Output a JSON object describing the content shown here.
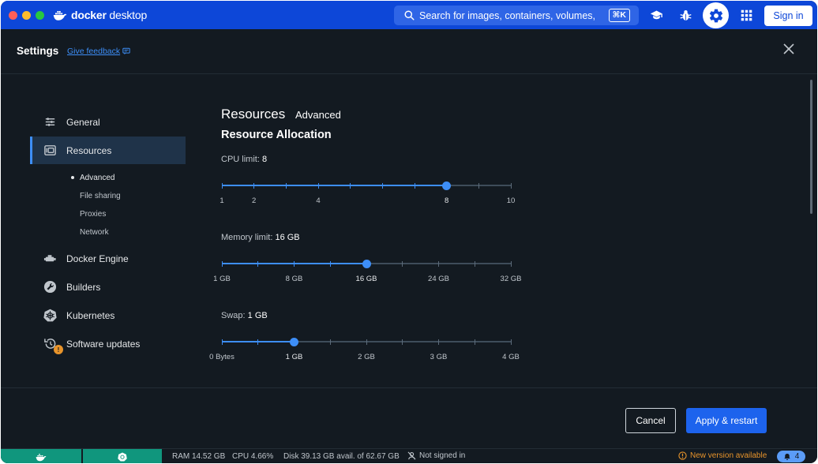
{
  "titlebar": {
    "brand": "docker desktop",
    "brand_bold": "docker",
    "brand_light": " desktop",
    "search_placeholder": "Search for images, containers, volumes, e...",
    "search_shortcut": "⌘K",
    "sign_in": "Sign in",
    "accent": "#0d47d8"
  },
  "header": {
    "title": "Settings",
    "feedback": "Give feedback"
  },
  "sidebar": {
    "items": [
      {
        "label": "General",
        "icon": "sliders-icon"
      },
      {
        "label": "Resources",
        "icon": "resources-icon",
        "active": true
      },
      {
        "label": "Docker Engine",
        "icon": "engine-icon"
      },
      {
        "label": "Builders",
        "icon": "wrench-icon"
      },
      {
        "label": "Kubernetes",
        "icon": "kubernetes-icon"
      },
      {
        "label": "Software updates",
        "icon": "update-clock-icon",
        "badge": "!"
      }
    ],
    "subitems": [
      {
        "label": "Advanced",
        "active": true
      },
      {
        "label": "File sharing"
      },
      {
        "label": "Proxies"
      },
      {
        "label": "Network"
      }
    ]
  },
  "main": {
    "heading": "Resources",
    "tab": "Advanced",
    "section": "Resource Allocation",
    "cpu": {
      "label": "CPU limit:",
      "value": "8",
      "min": 1,
      "max": 10,
      "current": 8,
      "ticks": [
        1,
        2,
        3,
        4,
        5,
        6,
        7,
        8,
        9,
        10
      ],
      "tick_labels": [
        "1",
        "2",
        "",
        "4",
        "",
        "",
        "",
        "8",
        "",
        "10"
      ]
    },
    "memory": {
      "label": "Memory limit:",
      "value": "16 GB",
      "min": 0,
      "max": 8,
      "current": 4,
      "ticks": [
        0,
        1,
        2,
        3,
        4,
        5,
        6,
        7,
        8
      ],
      "tick_labels": [
        "1 GB",
        "",
        "8 GB",
        "",
        "16 GB",
        "",
        "24 GB",
        "",
        "32 GB"
      ]
    },
    "swap": {
      "label": "Swap:",
      "value": "1 GB",
      "min": 0,
      "max": 8,
      "current": 2,
      "ticks": [
        0,
        1,
        2,
        3,
        4,
        5,
        6,
        7,
        8
      ],
      "tick_labels": [
        "0 Bytes",
        "",
        "1 GB",
        "",
        "2 GB",
        "",
        "3 GB",
        "",
        "4 GB"
      ]
    }
  },
  "footer": {
    "cancel": "Cancel",
    "apply": "Apply & restart"
  },
  "statusbar": {
    "ram": "RAM 14.52 GB",
    "cpu": "CPU 4.66%",
    "disk": "Disk 39.13 GB avail. of 62.67 GB",
    "signed": "Not signed in",
    "new_version": "New version available",
    "notifications": "4",
    "engine_color": "#10967d"
  }
}
